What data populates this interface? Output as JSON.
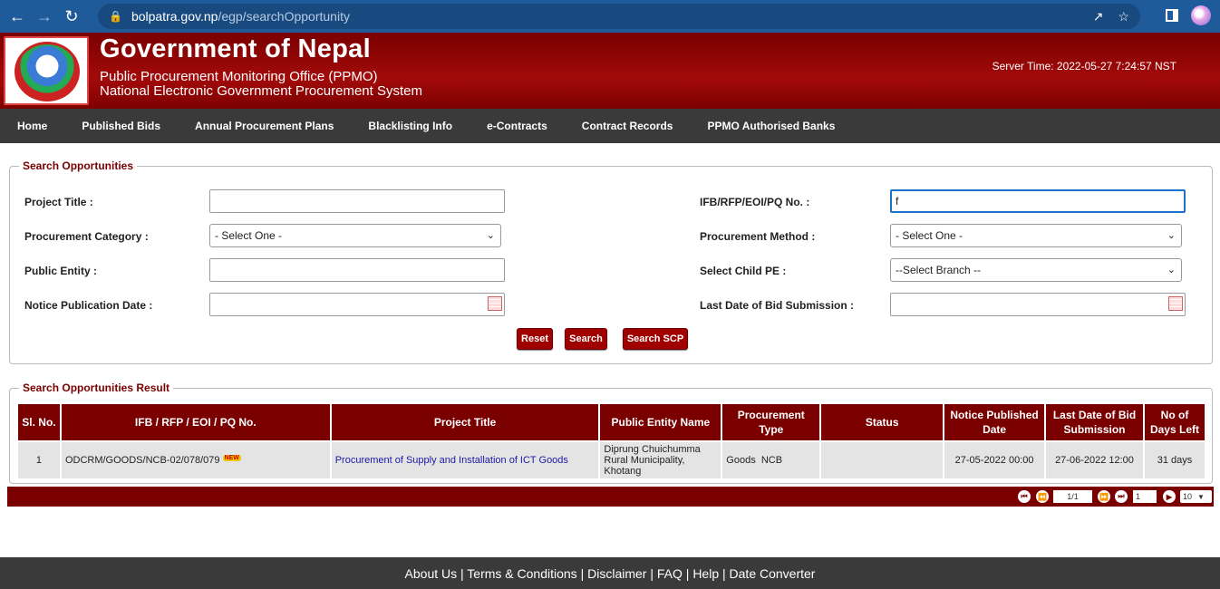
{
  "browser": {
    "url_host": "bolpatra.gov.np",
    "url_path": "/egp/searchOpportunity"
  },
  "header": {
    "title": "Government of Nepal",
    "subtitle1": "Public Procurement Monitoring Office (PPMO)",
    "subtitle2": "National Electronic Government Procurement System",
    "server_time": "Server Time: 2022-05-27 7:24:57 NST"
  },
  "menu": [
    "Home",
    "Published Bids",
    "Annual Procurement Plans",
    "Blacklisting Info",
    "e-Contracts",
    "Contract Records",
    "PPMO Authorised Banks"
  ],
  "search": {
    "legend": "Search Opportunities",
    "project_title_label": "Project Title :",
    "project_title_value": "",
    "ifb_label": "IFB/RFP/EOI/PQ No. :",
    "ifb_value": "f",
    "category_label": "Procurement Category :",
    "category_value": "- Select One -",
    "method_label": "Procurement Method :",
    "method_value": "- Select One -",
    "entity_label": "Public Entity :",
    "entity_value": "",
    "child_pe_label": "Select Child PE :",
    "child_pe_value": "--Select Branch --",
    "notice_date_label": "Notice Publication Date :",
    "notice_date_value": "",
    "last_date_label": "Last Date of Bid Submission :",
    "last_date_value": "",
    "reset_label": "Reset",
    "search_label": "Search",
    "search_scp_label": "Search SCP"
  },
  "results": {
    "legend": "Search Opportunities Result",
    "headers": [
      "Sl. No.",
      "IFB / RFP / EOI / PQ No.",
      "Project Title",
      "Public Entity Name",
      "Procurement Type",
      "Status",
      "Notice Published Date",
      "Last Date of Bid Submission",
      "No of Days Left"
    ],
    "rows": [
      {
        "sl": "1",
        "ifb": "ODCRM/GOODS/NCB-02/078/079",
        "badge": "NEW",
        "title": "Procurement of Supply and Installation of ICT Goods",
        "entity": "Diprung Chuichumma Rural Municipality, Khotang",
        "type": "Goods  NCB",
        "status": "",
        "notice_date": "27-05-2022 00:00",
        "last_date": "27-06-2022 12:00",
        "days_left": "31 days"
      }
    ]
  },
  "pager": {
    "page_info": "1/1",
    "page_input": "1",
    "page_size": "10"
  },
  "footer": {
    "links": [
      "About Us",
      "Terms & Conditions",
      "Disclaimer",
      "FAQ",
      "Help",
      "Date Converter"
    ]
  }
}
